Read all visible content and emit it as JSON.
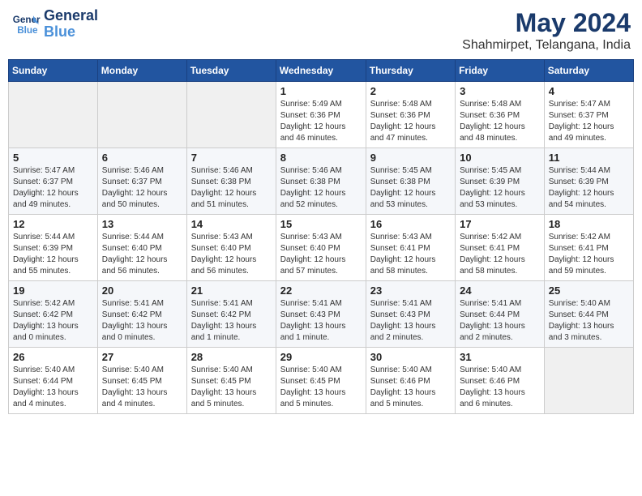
{
  "logo": {
    "line1": "General",
    "line2": "Blue"
  },
  "header": {
    "month": "May 2024",
    "location": "Shahmirpet, Telangana, India"
  },
  "days_of_week": [
    "Sunday",
    "Monday",
    "Tuesday",
    "Wednesday",
    "Thursday",
    "Friday",
    "Saturday"
  ],
  "weeks": [
    [
      {
        "day": "",
        "info": ""
      },
      {
        "day": "",
        "info": ""
      },
      {
        "day": "",
        "info": ""
      },
      {
        "day": "1",
        "info": "Sunrise: 5:49 AM\nSunset: 6:36 PM\nDaylight: 12 hours\nand 46 minutes."
      },
      {
        "day": "2",
        "info": "Sunrise: 5:48 AM\nSunset: 6:36 PM\nDaylight: 12 hours\nand 47 minutes."
      },
      {
        "day": "3",
        "info": "Sunrise: 5:48 AM\nSunset: 6:36 PM\nDaylight: 12 hours\nand 48 minutes."
      },
      {
        "day": "4",
        "info": "Sunrise: 5:47 AM\nSunset: 6:37 PM\nDaylight: 12 hours\nand 49 minutes."
      }
    ],
    [
      {
        "day": "5",
        "info": "Sunrise: 5:47 AM\nSunset: 6:37 PM\nDaylight: 12 hours\nand 49 minutes."
      },
      {
        "day": "6",
        "info": "Sunrise: 5:46 AM\nSunset: 6:37 PM\nDaylight: 12 hours\nand 50 minutes."
      },
      {
        "day": "7",
        "info": "Sunrise: 5:46 AM\nSunset: 6:38 PM\nDaylight: 12 hours\nand 51 minutes."
      },
      {
        "day": "8",
        "info": "Sunrise: 5:46 AM\nSunset: 6:38 PM\nDaylight: 12 hours\nand 52 minutes."
      },
      {
        "day": "9",
        "info": "Sunrise: 5:45 AM\nSunset: 6:38 PM\nDaylight: 12 hours\nand 53 minutes."
      },
      {
        "day": "10",
        "info": "Sunrise: 5:45 AM\nSunset: 6:39 PM\nDaylight: 12 hours\nand 53 minutes."
      },
      {
        "day": "11",
        "info": "Sunrise: 5:44 AM\nSunset: 6:39 PM\nDaylight: 12 hours\nand 54 minutes."
      }
    ],
    [
      {
        "day": "12",
        "info": "Sunrise: 5:44 AM\nSunset: 6:39 PM\nDaylight: 12 hours\nand 55 minutes."
      },
      {
        "day": "13",
        "info": "Sunrise: 5:44 AM\nSunset: 6:40 PM\nDaylight: 12 hours\nand 56 minutes."
      },
      {
        "day": "14",
        "info": "Sunrise: 5:43 AM\nSunset: 6:40 PM\nDaylight: 12 hours\nand 56 minutes."
      },
      {
        "day": "15",
        "info": "Sunrise: 5:43 AM\nSunset: 6:40 PM\nDaylight: 12 hours\nand 57 minutes."
      },
      {
        "day": "16",
        "info": "Sunrise: 5:43 AM\nSunset: 6:41 PM\nDaylight: 12 hours\nand 58 minutes."
      },
      {
        "day": "17",
        "info": "Sunrise: 5:42 AM\nSunset: 6:41 PM\nDaylight: 12 hours\nand 58 minutes."
      },
      {
        "day": "18",
        "info": "Sunrise: 5:42 AM\nSunset: 6:41 PM\nDaylight: 12 hours\nand 59 minutes."
      }
    ],
    [
      {
        "day": "19",
        "info": "Sunrise: 5:42 AM\nSunset: 6:42 PM\nDaylight: 13 hours\nand 0 minutes."
      },
      {
        "day": "20",
        "info": "Sunrise: 5:41 AM\nSunset: 6:42 PM\nDaylight: 13 hours\nand 0 minutes."
      },
      {
        "day": "21",
        "info": "Sunrise: 5:41 AM\nSunset: 6:42 PM\nDaylight: 13 hours\nand 1 minute."
      },
      {
        "day": "22",
        "info": "Sunrise: 5:41 AM\nSunset: 6:43 PM\nDaylight: 13 hours\nand 1 minute."
      },
      {
        "day": "23",
        "info": "Sunrise: 5:41 AM\nSunset: 6:43 PM\nDaylight: 13 hours\nand 2 minutes."
      },
      {
        "day": "24",
        "info": "Sunrise: 5:41 AM\nSunset: 6:44 PM\nDaylight: 13 hours\nand 2 minutes."
      },
      {
        "day": "25",
        "info": "Sunrise: 5:40 AM\nSunset: 6:44 PM\nDaylight: 13 hours\nand 3 minutes."
      }
    ],
    [
      {
        "day": "26",
        "info": "Sunrise: 5:40 AM\nSunset: 6:44 PM\nDaylight: 13 hours\nand 4 minutes."
      },
      {
        "day": "27",
        "info": "Sunrise: 5:40 AM\nSunset: 6:45 PM\nDaylight: 13 hours\nand 4 minutes."
      },
      {
        "day": "28",
        "info": "Sunrise: 5:40 AM\nSunset: 6:45 PM\nDaylight: 13 hours\nand 5 minutes."
      },
      {
        "day": "29",
        "info": "Sunrise: 5:40 AM\nSunset: 6:45 PM\nDaylight: 13 hours\nand 5 minutes."
      },
      {
        "day": "30",
        "info": "Sunrise: 5:40 AM\nSunset: 6:46 PM\nDaylight: 13 hours\nand 5 minutes."
      },
      {
        "day": "31",
        "info": "Sunrise: 5:40 AM\nSunset: 6:46 PM\nDaylight: 13 hours\nand 6 minutes."
      },
      {
        "day": "",
        "info": ""
      }
    ]
  ]
}
